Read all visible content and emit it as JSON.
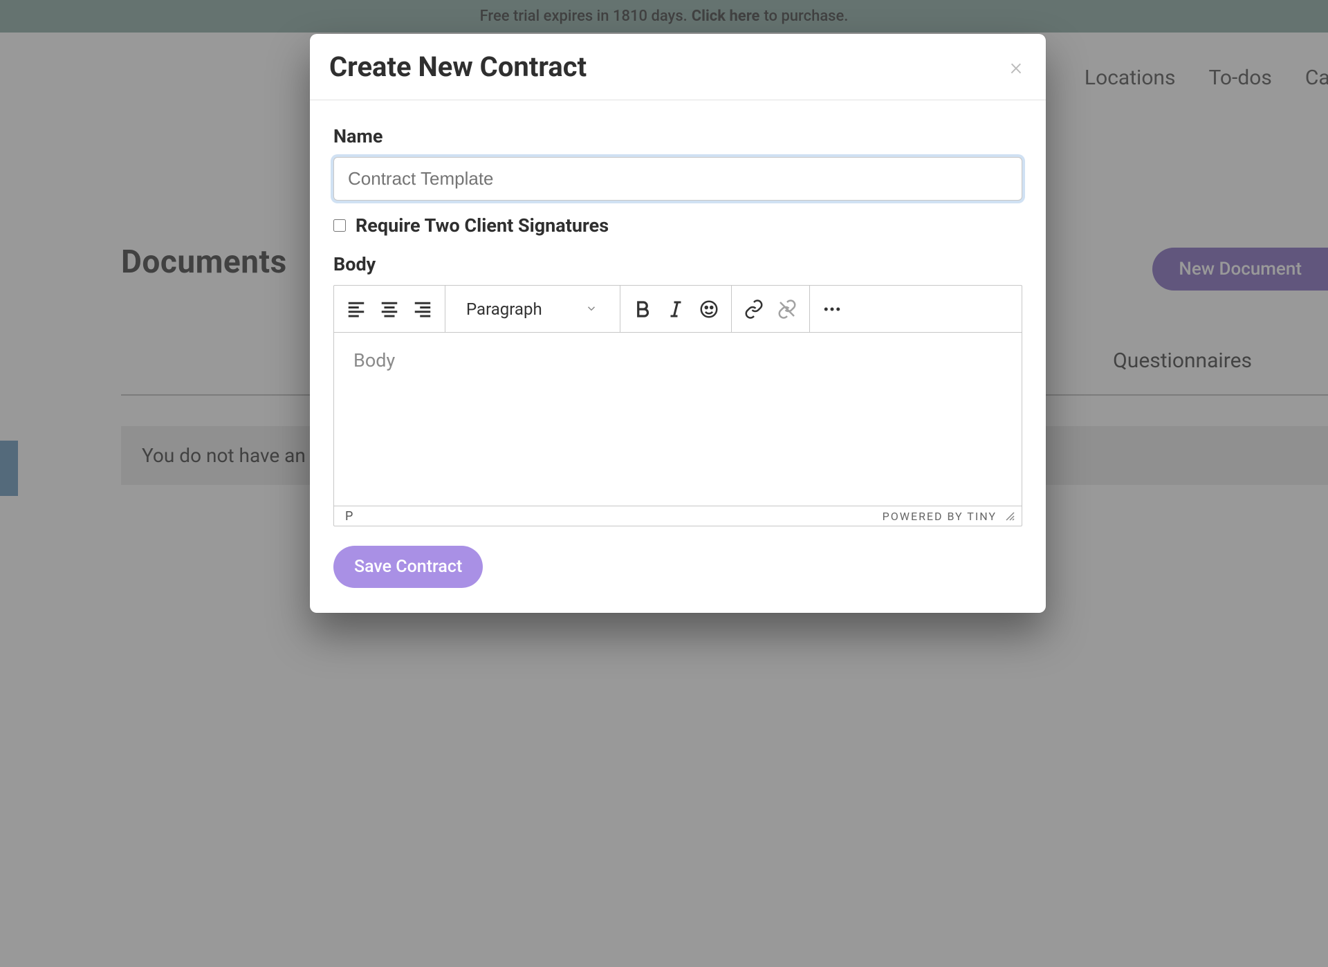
{
  "banner": {
    "prefix": "Free trial expires in 1810 days.",
    "cta": "Click here",
    "suffix": "to purchase."
  },
  "nav": {
    "locations": "Locations",
    "todos": "To-dos",
    "cal": "Cal"
  },
  "page": {
    "title": "Documents",
    "newDocument": "New Document",
    "tabs": {
      "questionnaires": "Questionnaires"
    },
    "emptyState": "You do not have an"
  },
  "modal": {
    "title": "Create New Contract",
    "nameLabel": "Name",
    "namePlaceholder": "Contract Template",
    "requireTwoSignatures": "Require Two Client Signatures",
    "bodyLabel": "Body",
    "toolbar": {
      "formatSelected": "Paragraph"
    },
    "bodyPlaceholder": "Body",
    "path": "P",
    "poweredBy": "POWERED BY TINY",
    "saveButton": "Save Contract"
  }
}
